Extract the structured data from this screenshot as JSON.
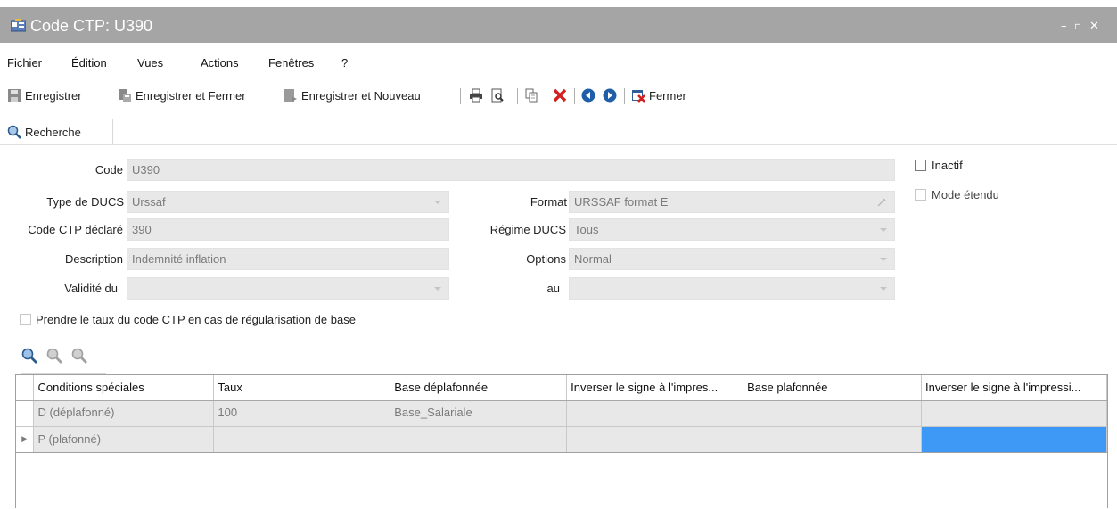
{
  "window": {
    "title": "Code CTP: U390",
    "minimize": "–",
    "maximize": "▫",
    "close": "✕"
  },
  "menu": [
    "Fichier",
    "Édition",
    "Vues",
    "Actions",
    "Fenêtres",
    "?"
  ],
  "toolbar": {
    "save": "Enregistrer",
    "save_close": "Enregistrer et Fermer",
    "save_new": "Enregistrer et Nouveau",
    "close": "Fermer"
  },
  "tab": {
    "label": "Recherche"
  },
  "form": {
    "code_label": "Code",
    "code_value": "U390",
    "type_label": "Type de DUCS",
    "type_value": "Urssaf",
    "ctp_label": "Code CTP déclaré",
    "ctp_value": "390",
    "desc_label": "Description",
    "desc_value": "Indemnité inflation",
    "validite_label": "Validité du",
    "validite_value": "",
    "format_label": "Format",
    "format_value": "URSSAF format E",
    "regime_label": "Régime DUCS",
    "regime_value": "Tous",
    "options_label": "Options",
    "options_value": "Normal",
    "au_label": "au",
    "au_value": "",
    "inactif_label": "Inactif",
    "inactif_checked": false,
    "mode_label": "Mode étendu",
    "mode_checked": false,
    "regul_label": "Prendre le taux du code CTP en cas de régularisation de base",
    "regul_checked": false
  },
  "grid": {
    "headers": [
      "Conditions spéciales",
      "Taux",
      "Base déplafonnée",
      "Inverser le signe à l'impres...",
      "Base plafonnée",
      "Inverser le signe à l'impressi..."
    ],
    "rows": [
      [
        "D (déplafonné)",
        "100",
        "Base_Salariale",
        "",
        "",
        ""
      ],
      [
        "P (plafonné)",
        "",
        "",
        "",
        "",
        ""
      ]
    ],
    "selected_row": 1,
    "selection_color": "#3d99f5"
  },
  "colors": {
    "titlebar": "#a5a5a5",
    "field_bg": "#e8e8e8"
  }
}
